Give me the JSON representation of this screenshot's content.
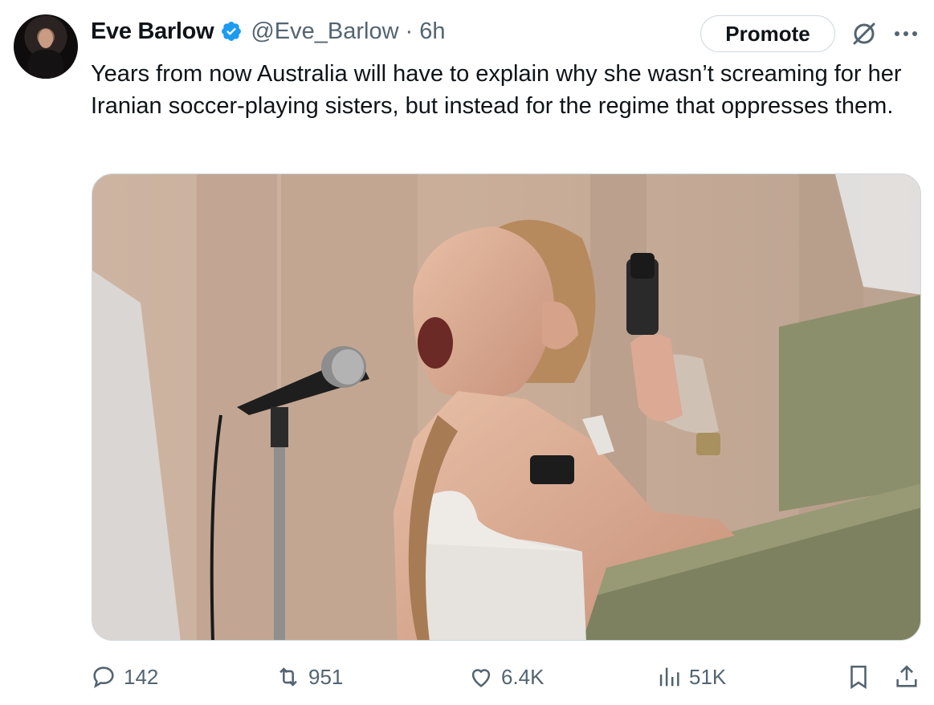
{
  "tweet": {
    "author_name": "Eve Barlow",
    "handle": "@Eve_Barlow",
    "separator": "·",
    "time": "6h",
    "promote_label": "Promote",
    "text": "Years from now Australia will have to explain why she wasn’t screaming for her Iranian soccer-playing sisters, but instead for the regime that oppresses them."
  },
  "actions": {
    "replies": "142",
    "reposts": "951",
    "likes": "6.4K",
    "views": "51K"
  },
  "icons": {
    "verified": "verified-badge-icon",
    "grok": "grok-icon",
    "more": "more-icon",
    "reply": "reply-icon",
    "repost": "repost-icon",
    "like": "heart-icon",
    "views": "views-icon",
    "bookmark": "bookmark-icon",
    "share": "share-icon"
  },
  "colors": {
    "verified": "#1d9bf0",
    "secondary_text": "#536471",
    "primary_text": "#0f1419"
  }
}
